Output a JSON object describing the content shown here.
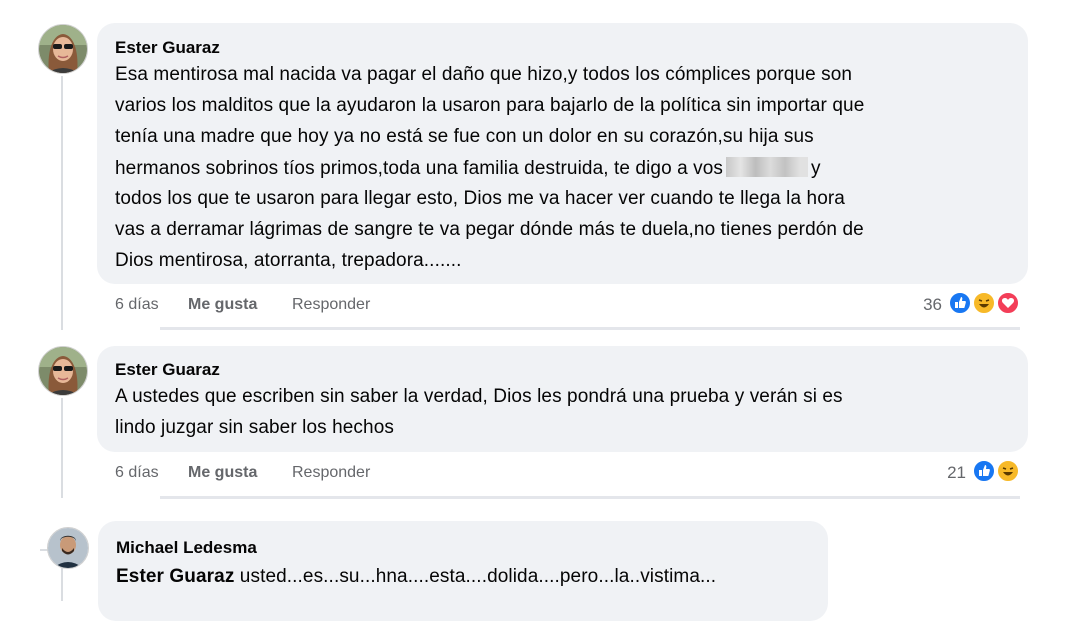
{
  "comments": [
    {
      "author": "Ester Guaraz",
      "avatar": "woman-sunglasses-avatar",
      "lines": [
        "Esa mentirosa mal nacida va pagar el daño que hizo,y todos los cómplices porque son",
        "varios los malditos que la ayudaron la usaron para bajarlo de la política sin importar que",
        "tenía una madre que hoy ya no está se fue con un dolor en su corazón,su hija sus",
        "hermanos sobrinos tíos primos,toda una familia destruida, te digo a vos",
        "todos los que te usaron para llegar esto, Dios me va hacer ver cuando te llega la hora",
        "vas a derramar lágrimas de sangre te va pegar dónde más te duela,no tienes perdón de",
        "Dios mentirosa, atorranta, trepadora......."
      ],
      "line4_suffix": "y",
      "time": "6 días",
      "like": "Me gusta",
      "reply": "Responder",
      "reaction_count": "36",
      "reactions": [
        "like",
        "haha",
        "love"
      ]
    },
    {
      "author": "Ester Guaraz",
      "avatar": "woman-sunglasses-avatar",
      "lines": [
        "A ustedes que escriben sin saber la verdad, Dios les pondrá una prueba y verán si es",
        "lindo juzgar sin saber los hechos"
      ],
      "time": "6 días",
      "like": "Me gusta",
      "reply": "Responder",
      "reaction_count": "21",
      "reactions": [
        "like",
        "haha"
      ]
    },
    {
      "author": "Michael Ledesma",
      "avatar": "man-avatar",
      "mention": "Ester Guaraz",
      "text": " usted...es...su...hna....esta....dolida....pero...la..vistima..."
    }
  ],
  "colors": {
    "bubble": "#f0f2f5",
    "like_blue": "#1877f2",
    "love_red": "#f33e58",
    "haha_yellow": "#f7b928"
  }
}
